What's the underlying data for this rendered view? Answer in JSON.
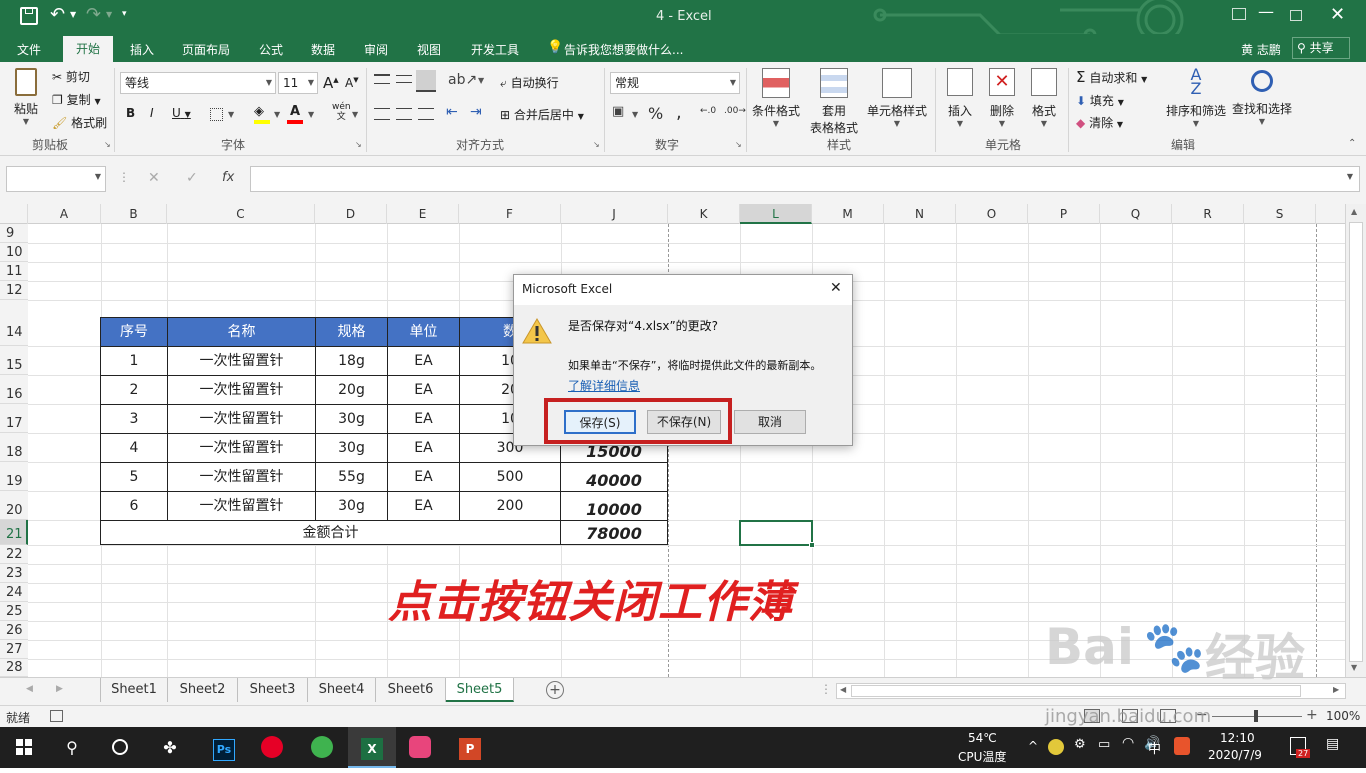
{
  "window": {
    "title": "4 - Excel",
    "user": "黄 志鹏",
    "share": "共享"
  },
  "qat": {
    "undo_label": "撤销",
    "redo_label": "恢复"
  },
  "tabs": [
    "文件",
    "开始",
    "插入",
    "页面布局",
    "公式",
    "数据",
    "审阅",
    "视图",
    "开发工具"
  ],
  "tellme": "告诉我您想要做什么...",
  "ribbon": {
    "clipboard": {
      "paste": "粘贴",
      "cut": "剪切",
      "copy": "复制",
      "format_painter": "格式刷",
      "label": "剪贴板"
    },
    "font": {
      "name": "等线",
      "size": "11",
      "bold": "B",
      "italic": "I",
      "underline": "U",
      "label": "字体",
      "grow": "A",
      "shrink": "A",
      "wen": "wén"
    },
    "alignment": {
      "wrap": "自动换行",
      "merge": "合并后居中",
      "label": "对齐方式"
    },
    "number": {
      "format": "常规",
      "percent": "%",
      "comma": ",",
      "label": "数字"
    },
    "styles": {
      "conditional": "条件格式",
      "table_format_1": "套用",
      "table_format_2": "表格格式",
      "cell_styles": "单元格样式",
      "label": "样式"
    },
    "cells": {
      "insert": "插入",
      "delete": "删除",
      "format": "格式",
      "label": "单元格"
    },
    "editing": {
      "autosum": "自动求和",
      "fill": "填充",
      "clear": "清除",
      "sort": "排序和筛选",
      "find": "查找和选择",
      "label": "编辑"
    }
  },
  "formula_bar": {
    "fx": "fx"
  },
  "columns": [
    "A",
    "B",
    "C",
    "D",
    "E",
    "F",
    "J",
    "K",
    "L",
    "M",
    "N",
    "O",
    "P",
    "Q",
    "R",
    "S"
  ],
  "rows": [
    "9",
    "10",
    "11",
    "12",
    "14",
    "15",
    "16",
    "17",
    "18",
    "19",
    "20",
    "21",
    "22",
    "23",
    "24",
    "25",
    "26",
    "27",
    "28"
  ],
  "table": {
    "headers": [
      "序号",
      "名称",
      "规格",
      "单位",
      "数"
    ],
    "rows": [
      [
        "1",
        "一次性留置针",
        "18g",
        "EA",
        "10"
      ],
      [
        "2",
        "一次性留置针",
        "20g",
        "EA",
        "20"
      ],
      [
        "3",
        "一次性留置针",
        "30g",
        "EA",
        "10"
      ],
      [
        "4",
        "一次性留置针",
        "30g",
        "EA",
        "300"
      ],
      [
        "5",
        "一次性留置针",
        "55g",
        "EA",
        "500"
      ],
      [
        "6",
        "一次性留置针",
        "30g",
        "EA",
        "200"
      ]
    ],
    "amounts": [
      "15000",
      "40000",
      "10000"
    ],
    "total_label": "金额合计",
    "total": "78000"
  },
  "annotation": "点击按钮关闭工作薄",
  "dialog": {
    "title": "Microsoft Excel",
    "question": "是否保存对“4.xlsx”的更改?",
    "info": "如果单击“不保存”，将临时提供此文件的最新副本。",
    "link": "了解详细信息",
    "save": "保存(S)",
    "dont_save": "不保存(N)",
    "cancel": "取消"
  },
  "sheets": [
    "Sheet1",
    "Sheet2",
    "Sheet3",
    "Sheet4",
    "Sheet6",
    "Sheet5"
  ],
  "active_sheet": "Sheet5",
  "status": {
    "ready": "就绪",
    "zoom": "100%"
  },
  "taskbar": {
    "temp": "54℃",
    "temp_label": "CPU温度",
    "time": "12:10",
    "date": "2020/7/9",
    "ime": "中",
    "ps_label": "Ps",
    "notif_count": "27"
  },
  "watermark": {
    "brand": "Bai",
    "brand2": "经验",
    "url": "jingyan.baidu.com"
  },
  "colors": {
    "excel_green": "#217346",
    "header_blue": "#4472c4",
    "highlight_red": "#c62020",
    "annotation_red": "#e02020"
  }
}
